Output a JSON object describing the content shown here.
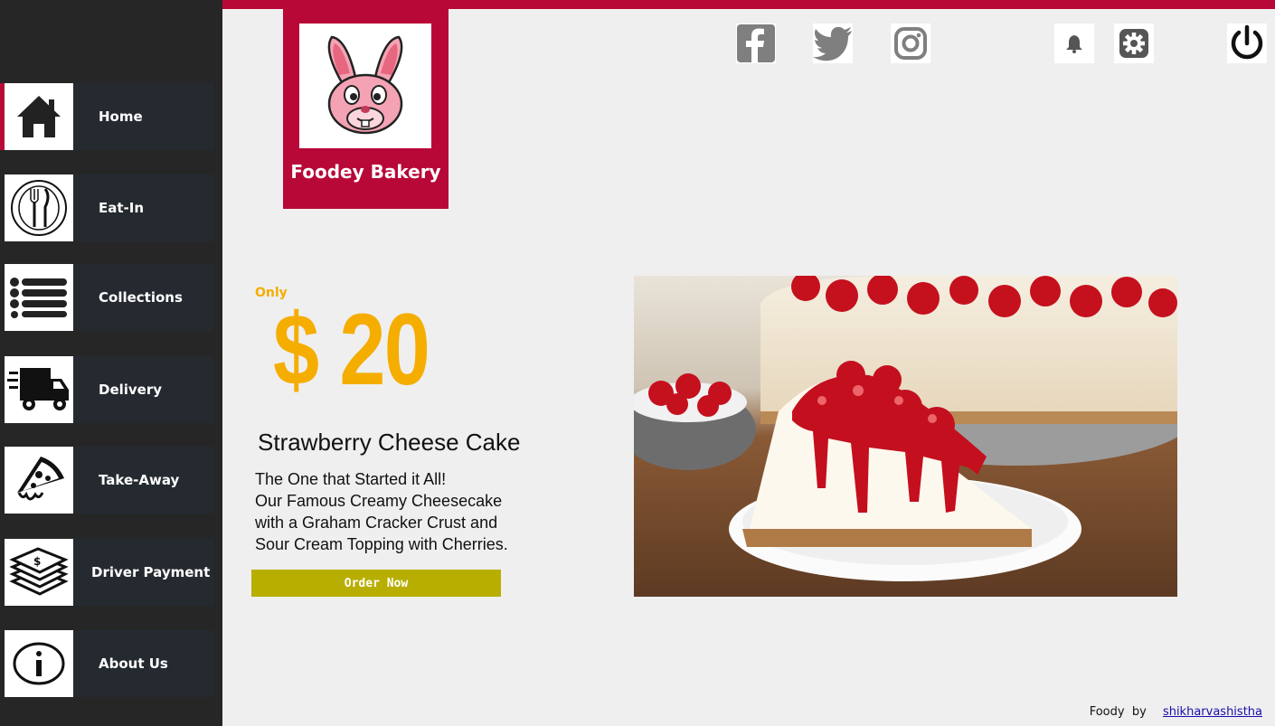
{
  "sidebar": {
    "items": [
      {
        "label": "Home",
        "icon": "home-icon",
        "active": true
      },
      {
        "label": "Eat-In",
        "icon": "fork-knife-plate-icon"
      },
      {
        "label": "Collections",
        "icon": "list-icon"
      },
      {
        "label": "Delivery",
        "icon": "delivery-truck-icon"
      },
      {
        "label": "Take-Away",
        "icon": "pizza-slice-icon"
      },
      {
        "label": "Driver Payment",
        "icon": "money-stack-icon"
      },
      {
        "label": "About Us",
        "icon": "info-icon"
      }
    ]
  },
  "brand": {
    "name": "Foodey Bakery",
    "logo_icon": "bunny-logo-icon"
  },
  "social": [
    "facebook-icon",
    "twitter-icon",
    "instagram-icon"
  ],
  "toolbar": [
    "bell-icon",
    "gear-icon",
    "power-icon"
  ],
  "promo": {
    "only": "Only",
    "price": "$ 20",
    "title": "Strawberry Cheese Cake",
    "description": [
      "The One that Started it All!",
      "Our Famous Creamy Cheesecake",
      "with a Graham Cracker Crust and",
      "Sour Cream Topping with Cherries."
    ],
    "button": "Order Now",
    "image": "cheesecake-photo"
  },
  "footer": {
    "text": "Foody  by",
    "link": "shikharvashistha"
  },
  "colors": {
    "accent": "#b80838",
    "price": "#f5ad00",
    "button": "#b8ae00",
    "sidebar": "#262626",
    "nav_item": "#252a30"
  }
}
